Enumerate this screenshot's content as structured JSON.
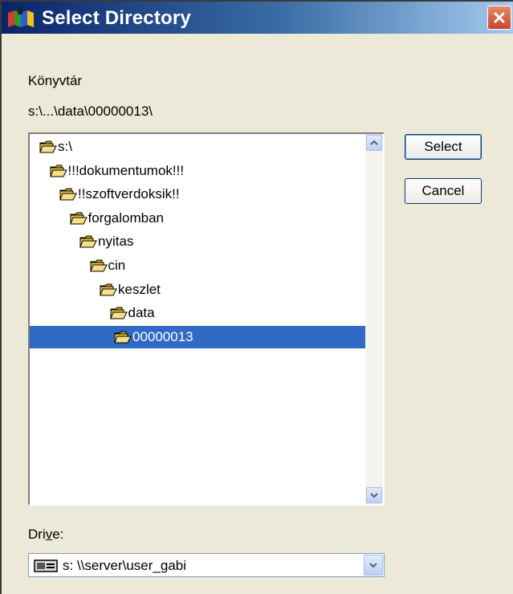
{
  "window": {
    "title": "Select Directory",
    "app_icon": "app-flag-icon",
    "close_icon": "close-icon"
  },
  "labels": {
    "directory": "Könyvtár",
    "current_path": "s:\\...\\data\\00000013\\",
    "drive_prefix": "Dri",
    "drive_accel": "v",
    "drive_suffix": "e:"
  },
  "tree": {
    "nodes": [
      {
        "label": "s:\\",
        "level": 0,
        "selected": false
      },
      {
        "label": "!!!dokumentumok!!!",
        "level": 1,
        "selected": false
      },
      {
        "label": "!!szoftverdoksik!!",
        "level": 2,
        "selected": false
      },
      {
        "label": "forgalomban",
        "level": 3,
        "selected": false
      },
      {
        "label": "nyitas",
        "level": 4,
        "selected": false
      },
      {
        "label": "cin",
        "level": 5,
        "selected": false
      },
      {
        "label": "keszlet",
        "level": 6,
        "selected": false
      },
      {
        "label": "data",
        "level": 7,
        "selected": false
      },
      {
        "label": "00000013",
        "level": 8,
        "selected": true
      }
    ]
  },
  "buttons": {
    "select": "Select",
    "cancel": "Cancel"
  },
  "drive_combo": {
    "value": "s: \\\\server\\user_gabi",
    "icon": "network-drive-icon"
  },
  "colors": {
    "selection": "#316ac5",
    "dialog_bg": "#ece9d8",
    "title_start": "#0a246a",
    "close_button": "#c9452b"
  }
}
